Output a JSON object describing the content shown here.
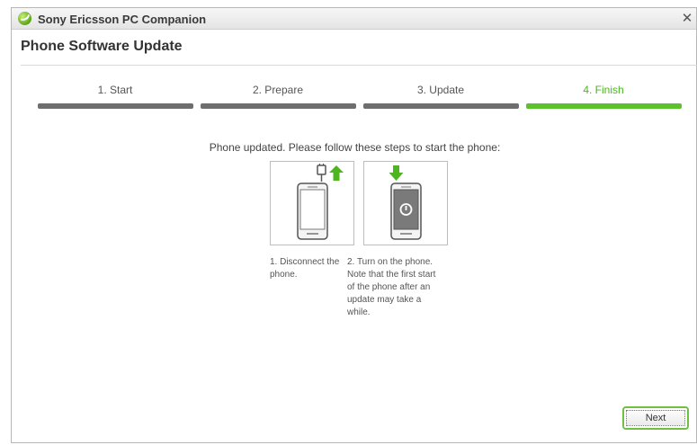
{
  "window": {
    "title": "Sony Ericsson PC Companion",
    "close_glyph": "✕"
  },
  "page": {
    "heading": "Phone Software Update"
  },
  "steps": [
    {
      "label": "1. Start",
      "state": "done"
    },
    {
      "label": "2. Prepare",
      "state": "done"
    },
    {
      "label": "3. Update",
      "state": "done"
    },
    {
      "label": "4. Finish",
      "state": "current"
    }
  ],
  "colors": {
    "accent": "#5bc12d",
    "step_done": "#6e6e6e",
    "step_current_text": "#4db521"
  },
  "finish": {
    "instruction": "Phone updated. Please follow these steps to start the phone:",
    "cards": [
      {
        "icon": "phone-disconnect-icon",
        "caption": "1. Disconnect the phone."
      },
      {
        "icon": "phone-power-on-icon",
        "caption": "2. Turn on the phone. Note that the first start of the phone after an update may take a while."
      }
    ]
  },
  "footer": {
    "next_label": "Next"
  }
}
